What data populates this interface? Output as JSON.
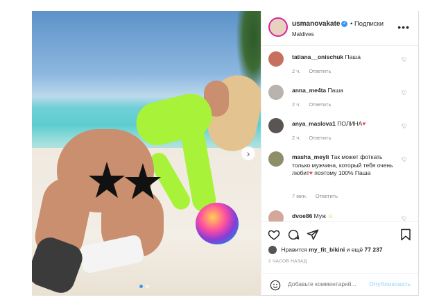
{
  "post": {
    "username": "usmanovakate",
    "follow_label": "• Подписки",
    "location": "Maldives",
    "more_label": "•••"
  },
  "comments": [
    {
      "username": "tatiana__onischuk",
      "text": "Паша",
      "time": "2 ч.",
      "reply": "Ответить",
      "avatar_color": "#c7705e"
    },
    {
      "username": "anna_me4ta",
      "text": "Паша",
      "time": "2 ч.",
      "reply": "Ответить",
      "avatar_color": "#b9b3ad"
    },
    {
      "username": "anya_maslova1",
      "text": "ПОЛИНА",
      "time": "2 ч.",
      "reply": "Ответить",
      "avatar_color": "#5a5452"
    },
    {
      "username": "masha_meyli",
      "text_part1": "Так может фоткать только мужчина, который тебя очень любит",
      "text_part2": " поэтому 100% Паша",
      "time": "7 мин.",
      "reply": "Ответить",
      "avatar_color": "#8e8f6a"
    },
    {
      "username": "dvoe86",
      "text": "Муж",
      "avatar_color": "#d4a79a"
    }
  ],
  "likes": {
    "prefix": "Нравится",
    "user": "my_fit_bikini",
    "suffix": "и ещё",
    "count": "77 237"
  },
  "time_ago": "2 ЧАСОВ НАЗАД",
  "add_comment": {
    "placeholder": "Добавьте комментарий...",
    "post_label": "Опубликовать"
  },
  "colors": {
    "link_blue": "#3897f0",
    "post_disabled": "#b2dffc",
    "heart_red": "#ed4956",
    "muted": "#8e8e8e"
  },
  "icons": [
    "heart-icon",
    "comment-icon",
    "share-icon",
    "bookmark-icon",
    "emoji-icon",
    "verified-icon",
    "chevron-right-icon",
    "more-icon"
  ]
}
